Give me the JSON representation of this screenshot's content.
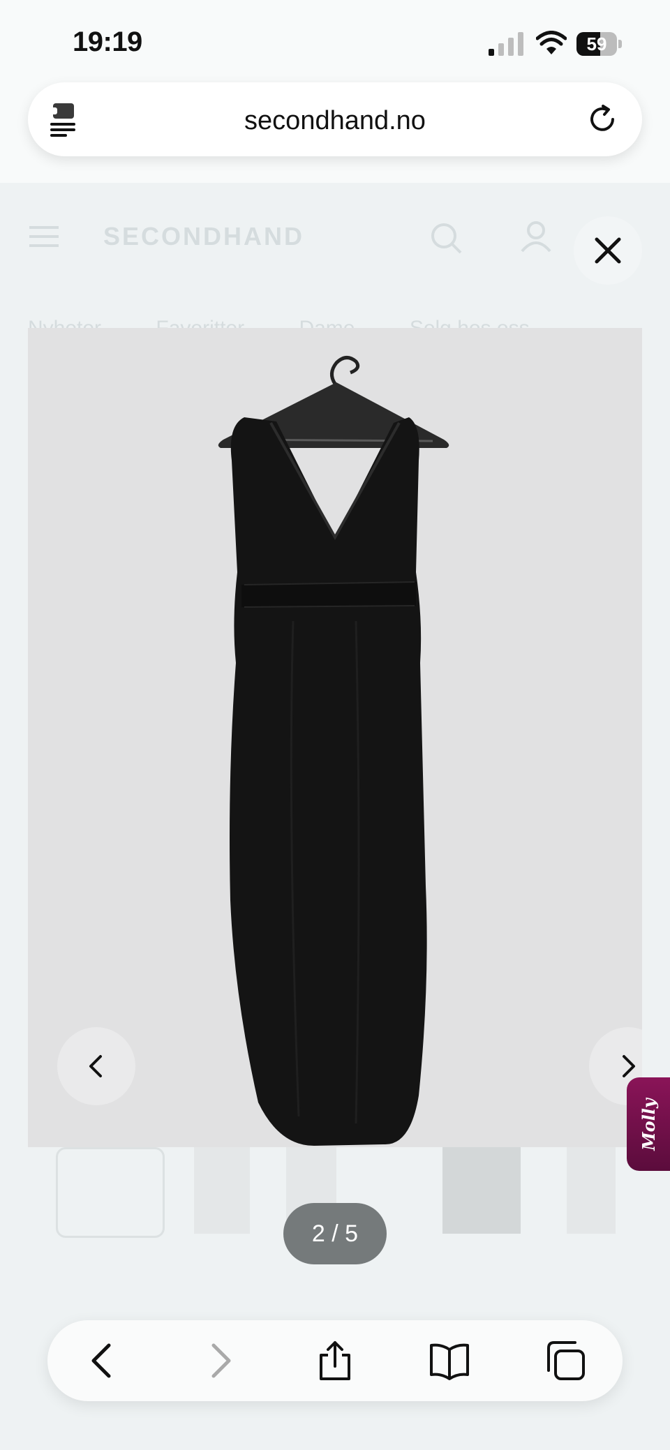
{
  "status_bar": {
    "time": "19:19",
    "battery_level": "59",
    "battery_fraction": 0.59,
    "icons": [
      "signal-icon",
      "wifi-icon",
      "battery-icon"
    ]
  },
  "browser": {
    "url": "secondhand.no",
    "icons": [
      "extension-icon",
      "reload-icon"
    ]
  },
  "site": {
    "logo": "SECONDHAND",
    "nav": [
      "Nyheter",
      "Favoritter",
      "Dame",
      "Selg hos oss"
    ],
    "icons": [
      "menu-icon",
      "search-icon",
      "account-icon",
      "bag-icon"
    ]
  },
  "gallery": {
    "counter": "2 / 5",
    "current": 2,
    "total": 5,
    "icons": [
      "close-icon",
      "chevron-left-icon",
      "chevron-right-icon"
    ]
  },
  "chat_widget": {
    "label": "Molly",
    "color": "#7a1250"
  },
  "toolbar": {
    "icons": [
      "back-icon",
      "forward-icon",
      "share-icon",
      "bookmarks-icon",
      "tabs-icon"
    ]
  }
}
